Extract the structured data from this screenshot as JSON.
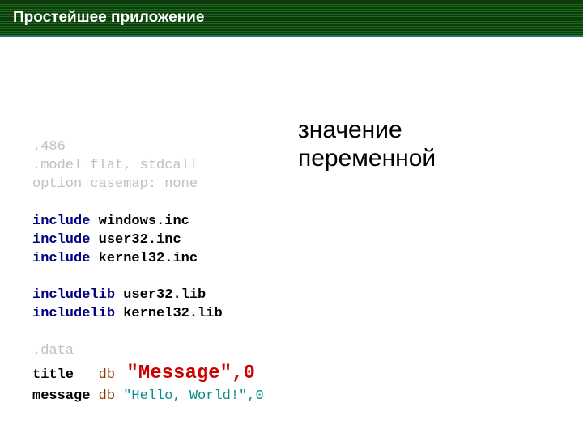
{
  "header": {
    "title": "Простейшее приложение"
  },
  "code": {
    "l1": ".486",
    "l2": ".model flat, stdcall",
    "l3": "option casemap: none",
    "l4": "include",
    "l4v": " windows.inc",
    "l5": "include",
    "l5v": " user32.inc",
    "l6": "include",
    "l6v": " kernel32.inc",
    "l7": "includelib",
    "l7v": " user32.lib",
    "l8": "includelib",
    "l8v": " kernel32.lib",
    "l9": ".data",
    "l10a": "title   ",
    "l10b": "db",
    "l10c": " \"Message\"",
    "l10d": ",0",
    "l11a": "message ",
    "l11b": "db",
    "l11c": " \"Hello, World!\",0"
  },
  "annotation": {
    "line1": "значение",
    "line2": "переменной"
  }
}
